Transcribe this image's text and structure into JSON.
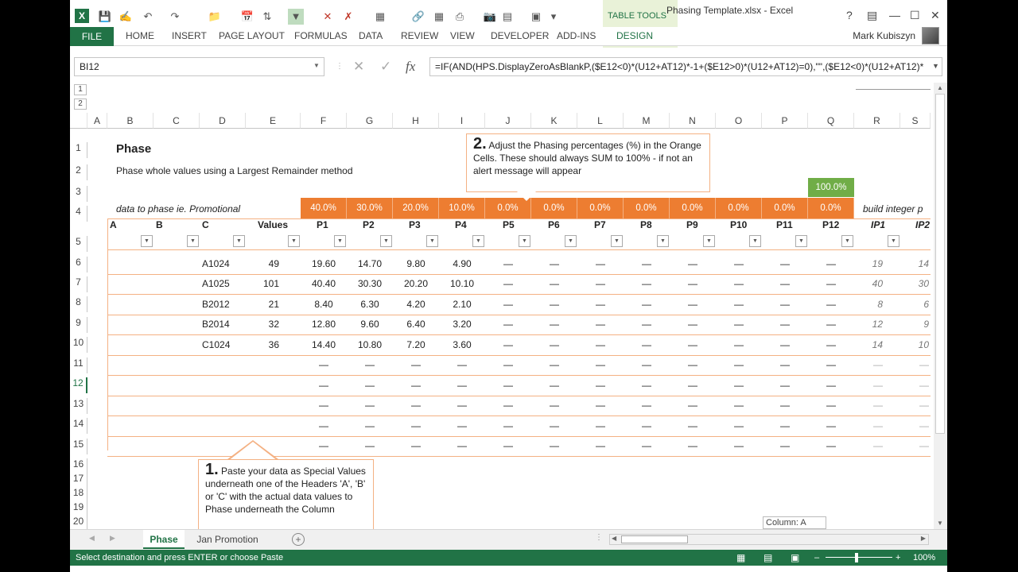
{
  "window": {
    "title": "Phasing Template.xlsx - Excel",
    "table_tools": "TABLE TOOLS",
    "user": "Mark Kubiszyn"
  },
  "ribbon_tabs": [
    "FILE",
    "HOME",
    "INSERT",
    "PAGE LAYOUT",
    "FORMULAS",
    "DATA",
    "REVIEW",
    "VIEW",
    "DEVELOPER",
    "ADD-INS",
    "DESIGN"
  ],
  "name_box": "BI12",
  "formula": "=IF(AND(HPS.DisplayZeroAsBlankP,($E12<0)*(U12+AT12)*-1+($E12>0)*(U12+AT12)=0),\"\",($E12<0)*(U12+AT12)*",
  "column_headers": [
    "A",
    "B",
    "C",
    "D",
    "E",
    "F",
    "G",
    "H",
    "I",
    "J",
    "K",
    "L",
    "M",
    "N",
    "O",
    "P",
    "Q",
    "R",
    "S"
  ],
  "outline_levels": [
    "1",
    "2"
  ],
  "rows": [
    "1",
    "2",
    "3",
    "4",
    "5",
    "6",
    "7",
    "8",
    "9",
    "10",
    "11",
    "12",
    "13",
    "14",
    "15",
    "16",
    "17",
    "18",
    "19",
    "20"
  ],
  "sheet": {
    "title": "Phase",
    "subtitle": "Phase whole values using a Largest Remainder method",
    "total_pct": "100.0%",
    "data_label": "data to phase ie. Promotional",
    "build_label": "build integer p",
    "percentages": [
      "40.0%",
      "30.0%",
      "20.0%",
      "10.0%",
      "0.0%",
      "0.0%",
      "0.0%",
      "0.0%",
      "0.0%",
      "0.0%",
      "0.0%",
      "0.0%"
    ],
    "headers": [
      "A",
      "B",
      "C",
      "Values",
      "P1",
      "P2",
      "P3",
      "P4",
      "P5",
      "P6",
      "P7",
      "P8",
      "P9",
      "P10",
      "P11",
      "P12",
      "IP1",
      "IP2"
    ],
    "data_rows": [
      {
        "c": "A1024",
        "v": "49",
        "p": [
          "19.60",
          "14.70",
          "9.80",
          "4.90",
          "—",
          "—",
          "—",
          "—",
          "—",
          "—",
          "—",
          "—"
        ],
        "ip1": "19",
        "ip2": "14"
      },
      {
        "c": "A1025",
        "v": "101",
        "p": [
          "40.40",
          "30.30",
          "20.20",
          "10.10",
          "—",
          "—",
          "—",
          "—",
          "—",
          "—",
          "—",
          "—"
        ],
        "ip1": "40",
        "ip2": "30"
      },
      {
        "c": "B2012",
        "v": "21",
        "p": [
          "8.40",
          "6.30",
          "4.20",
          "2.10",
          "—",
          "—",
          "—",
          "—",
          "—",
          "—",
          "—",
          "—"
        ],
        "ip1": "8",
        "ip2": "6"
      },
      {
        "c": "B2014",
        "v": "32",
        "p": [
          "12.80",
          "9.60",
          "6.40",
          "3.20",
          "—",
          "—",
          "—",
          "—",
          "—",
          "—",
          "—",
          "—"
        ],
        "ip1": "12",
        "ip2": "9"
      },
      {
        "c": "C1024",
        "v": "36",
        "p": [
          "14.40",
          "10.80",
          "7.20",
          "3.60",
          "—",
          "—",
          "—",
          "—",
          "—",
          "—",
          "—",
          "—"
        ],
        "ip1": "14",
        "ip2": "10"
      }
    ],
    "empty_mark": "—"
  },
  "callout1": {
    "num": "1.",
    "text": "Paste your data as Special Values underneath one of the Headers 'A', 'B' or 'C' with the actual data values to Phase underneath the Column"
  },
  "callout2": {
    "num": "2.",
    "text": "Adjust the Phasing percentages (%) in the Orange Cells.  These should always SUM to 100% - if not an alert message will appear"
  },
  "tooltip": "Column: A",
  "sheet_tabs": [
    "Phase",
    "Jan Promotion"
  ],
  "status": {
    "message": "Select destination and press ENTER or choose Paste",
    "zoom": "100%"
  },
  "colors": {
    "excel_green": "#217346",
    "orange": "#ed7d31",
    "green_total": "#70ad47"
  }
}
